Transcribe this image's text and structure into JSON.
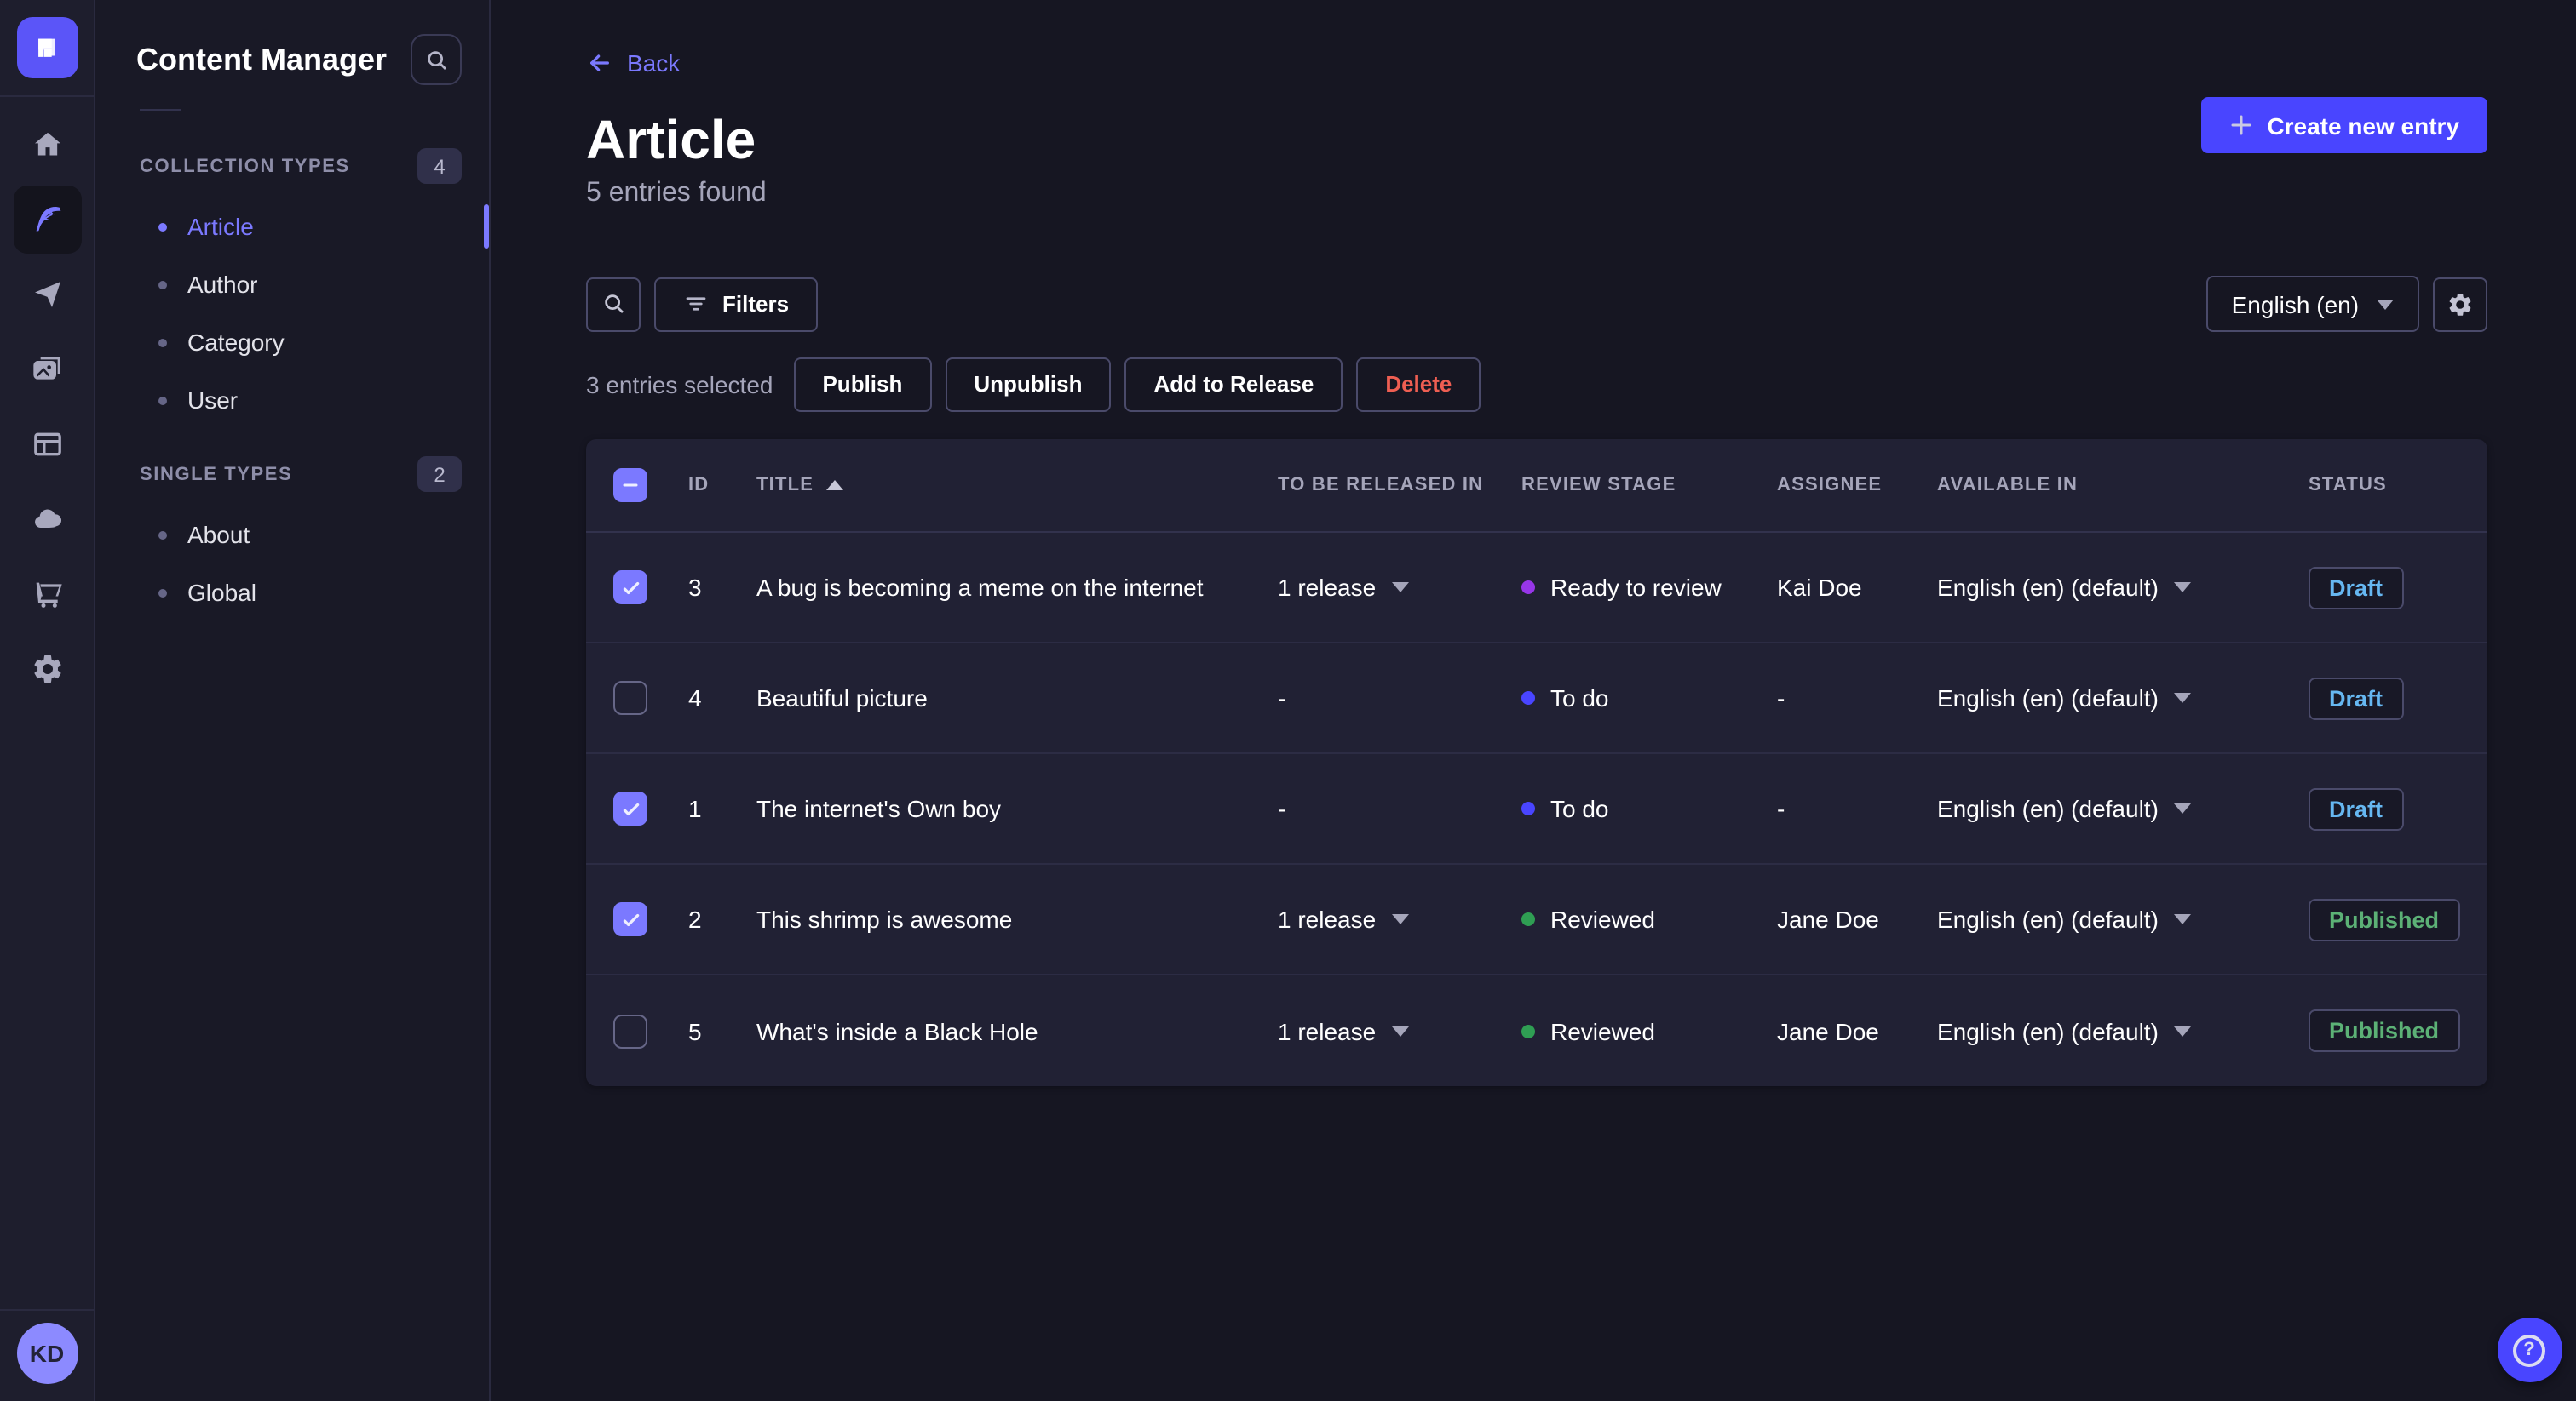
{
  "app": {
    "logo_color": "#5b55f8",
    "rail_icons": [
      "strapi-logo-icon",
      "home-icon",
      "feather-icon",
      "paper-plane-icon",
      "media-library-icon",
      "content-type-builder-icon",
      "cloud-icon",
      "cart-icon",
      "gear-icon"
    ],
    "avatar_initials": "KD"
  },
  "subnav": {
    "title": "Content Manager",
    "sections": [
      {
        "label": "COLLECTION TYPES",
        "count": "4",
        "items": [
          {
            "label": "Article",
            "active": true
          },
          {
            "label": "Author",
            "active": false
          },
          {
            "label": "Category",
            "active": false
          },
          {
            "label": "User",
            "active": false
          }
        ]
      },
      {
        "label": "SINGLE TYPES",
        "count": "2",
        "items": [
          {
            "label": "About",
            "active": false
          },
          {
            "label": "Global",
            "active": false
          }
        ]
      }
    ]
  },
  "header": {
    "back_label": "Back",
    "title": "Article",
    "subtitle": "5 entries found",
    "create_button": "Create new entry"
  },
  "toolbar": {
    "filters_label": "Filters",
    "locale_value": "English (en)"
  },
  "selection": {
    "text": "3 entries selected",
    "publish": "Publish",
    "unpublish": "Unpublish",
    "add_to_release": "Add to Release",
    "delete": "Delete"
  },
  "table": {
    "select_all_state": "indeterminate",
    "columns": {
      "id": "ID",
      "title": "TITLE",
      "released": "TO BE RELEASED IN",
      "review": "REVIEW STAGE",
      "assignee": "ASSIGNEE",
      "available": "AVAILABLE IN",
      "status": "STATUS"
    },
    "sorted_column": "TITLE",
    "sort_direction": "asc",
    "rows": [
      {
        "checked": true,
        "id": "3",
        "title": "A bug is becoming a meme on the internet",
        "released": "1 release",
        "stage": "Ready to review",
        "stage_color": "#9736e8",
        "assignee": "Kai Doe",
        "available": "English (en) (default)",
        "status": "Draft",
        "variant": "draft"
      },
      {
        "checked": false,
        "id": "4",
        "title": "Beautiful picture",
        "released": "-",
        "stage": "To do",
        "stage_color": "#4945ff",
        "assignee": "-",
        "available": "English (en) (default)",
        "status": "Draft",
        "variant": "draft"
      },
      {
        "checked": true,
        "id": "1",
        "title": "The internet's Own boy",
        "released": "-",
        "stage": "To do",
        "stage_color": "#4945ff",
        "assignee": "-",
        "available": "English (en) (default)",
        "status": "Draft",
        "variant": "draft"
      },
      {
        "checked": true,
        "id": "2",
        "title": "This shrimp is awesome",
        "released": "1 release",
        "stage": "Reviewed",
        "stage_color": "#2f9e53",
        "assignee": "Jane Doe",
        "available": "English (en) (default)",
        "status": "Published",
        "variant": "published"
      },
      {
        "checked": false,
        "id": "5",
        "title": "What's inside a Black Hole",
        "released": "1 release",
        "stage": "Reviewed",
        "stage_color": "#2f9e53",
        "assignee": "Jane Doe",
        "available": "English (en) (default)",
        "status": "Published",
        "variant": "published"
      }
    ]
  },
  "colors": {
    "accent": "#7b79ff",
    "primary_button": "#4945ff",
    "draft": "#66b7f1",
    "published": "#5cb176",
    "danger": "#ee5e52",
    "panel_bg": "#212134",
    "page_bg": "#161622"
  }
}
